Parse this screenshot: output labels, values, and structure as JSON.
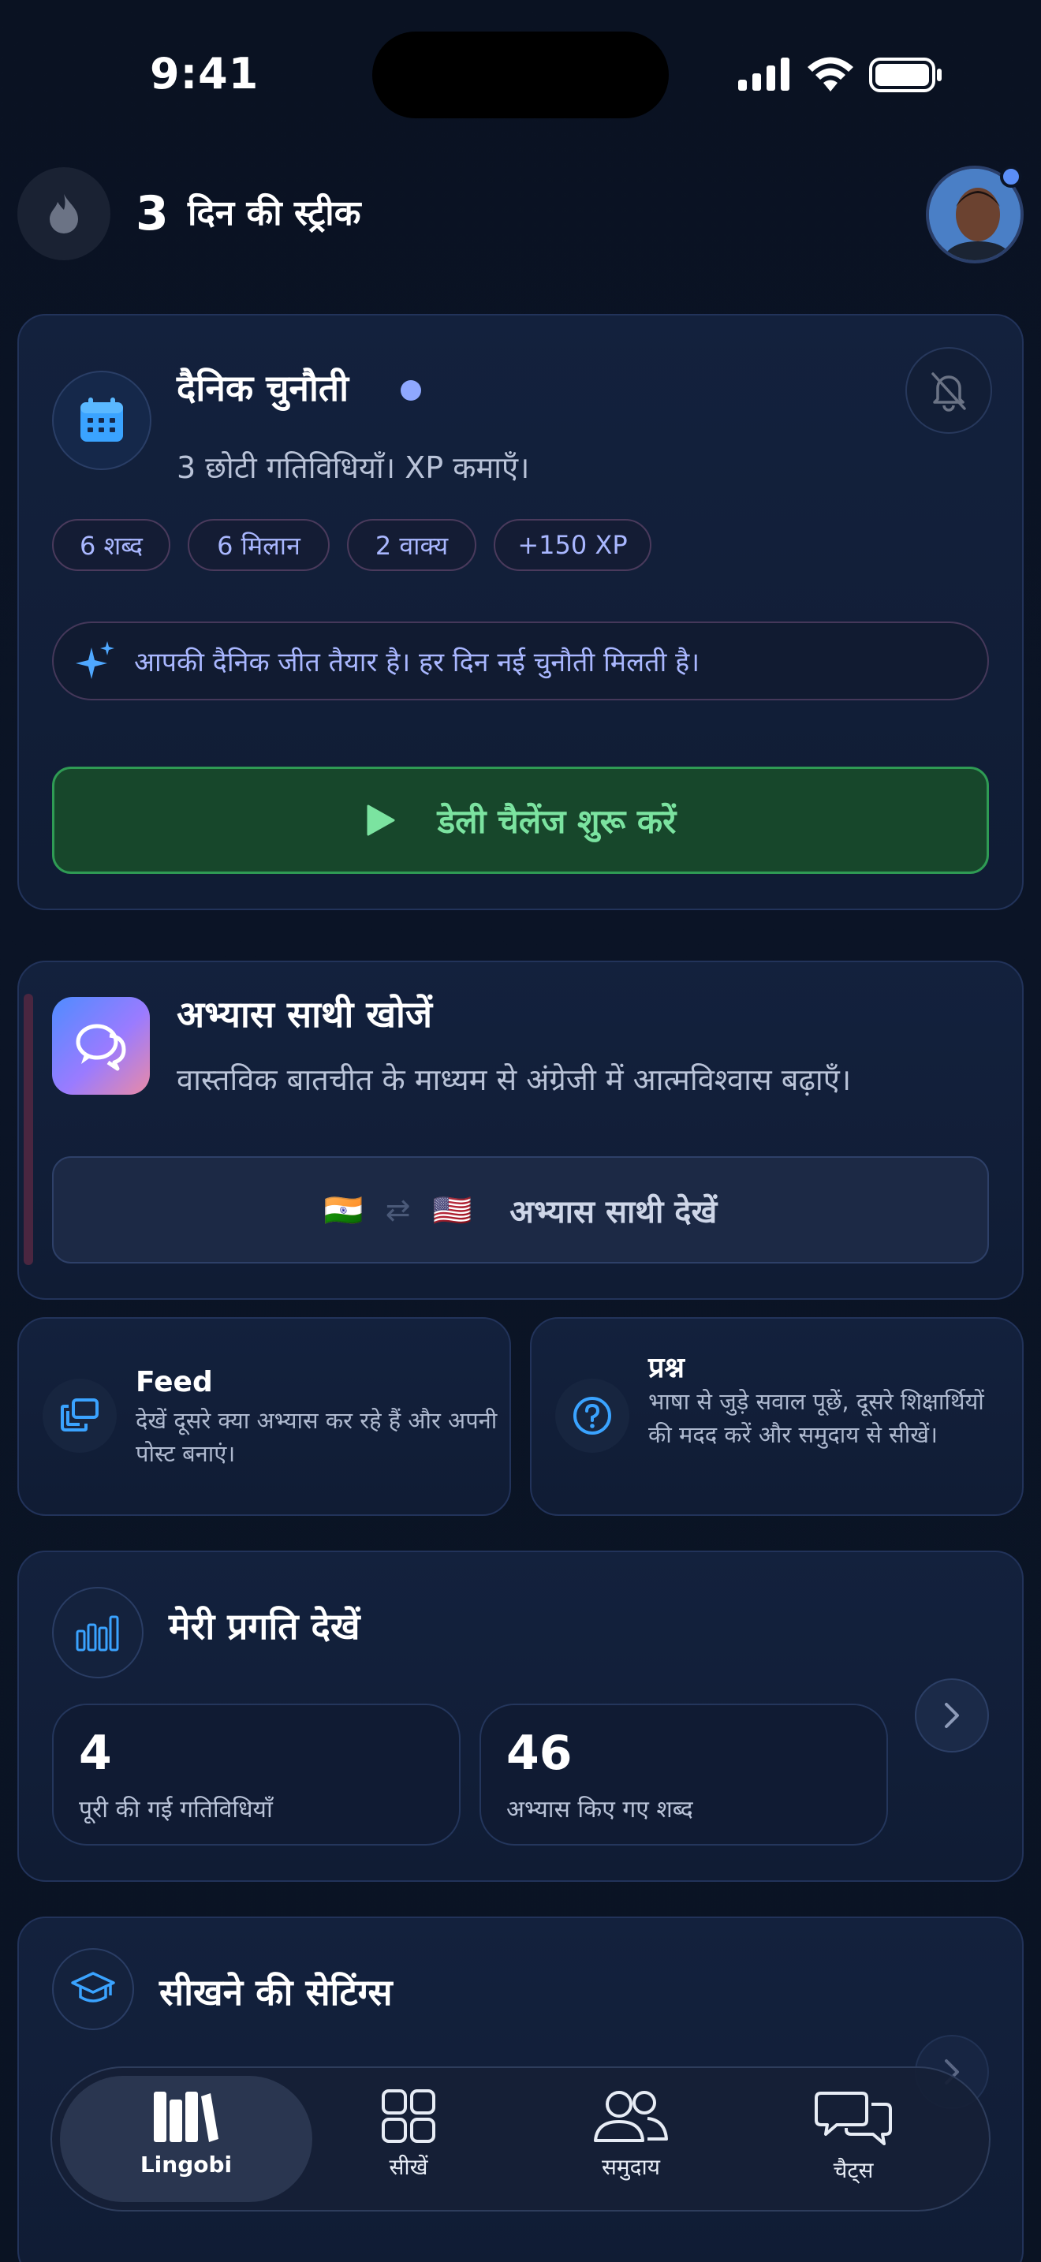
{
  "status_bar": {
    "time": "9:41"
  },
  "header": {
    "streak_count": "3",
    "streak_label": "दिन की स्ट्रीक"
  },
  "daily_challenge": {
    "title": "दैनिक चुनौती",
    "subtitle": "3 छोटी गतिविधियाँ। XP कमाएँ।",
    "chips": [
      "6 शब्द",
      "6 मिलान",
      "2 वाक्य",
      "+150 XP"
    ],
    "notice": "आपकी दैनिक जीत तैयार है। हर दिन नई चुनौती मिलती है।",
    "start_button": "डेली चैलेंज शुरू करें"
  },
  "practice_partner": {
    "title": "अभ्यास साथी खोजें",
    "subtitle": "वास्तविक बातचीत के माध्यम से अंग्रेजी में आत्मविश्वास बढ़ाएँ।",
    "button": "अभ्यास साथी देखें",
    "flag_from": "🇮🇳",
    "swap_icon": "⇄",
    "flag_to": "🇺🇸"
  },
  "feed": {
    "title": "Feed",
    "description": "देखें दूसरे क्या अभ्यास कर रहे हैं और अपनी पोस्ट बनाएं।"
  },
  "questions": {
    "title": "प्रश्न",
    "description": "भाषा से जुड़े सवाल पूछें, दूसरे शिक्षार्थियों की मदद करें और समुदाय से सीखें।"
  },
  "progress": {
    "title": "मेरी प्रगति देखें",
    "stats": [
      {
        "value": "4",
        "label": "पूरी की गई गतिविधियाँ"
      },
      {
        "value": "46",
        "label": "अभ्यास किए गए शब्द"
      }
    ]
  },
  "settings": {
    "title": "सीखने की सेटिंग्स"
  },
  "tabbar": {
    "tabs": [
      {
        "label": "Lingobi",
        "icon": "library-icon"
      },
      {
        "label": "सीखें",
        "icon": "grid-icon"
      },
      {
        "label": "समुदाय",
        "icon": "people-icon"
      },
      {
        "label": "चैट्स",
        "icon": "chat-bubbles-icon"
      }
    ]
  },
  "colors": {
    "background": "#0b1426",
    "accent_blue": "#8fa8ff",
    "accent_green": "#7be3a0",
    "card_border": "#22335a"
  }
}
